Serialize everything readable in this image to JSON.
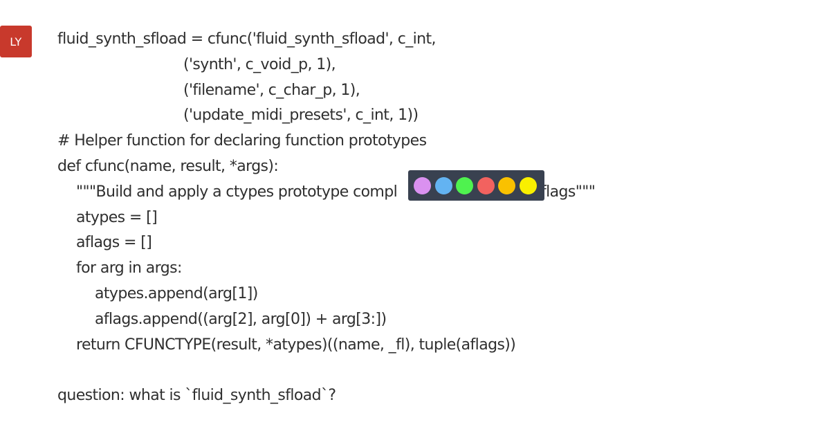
{
  "user": {
    "initials": "LY",
    "avatar_color": "#c8392c"
  },
  "message": {
    "code_lines": [
      "fluid_synth_sfload = cfunc('fluid_synth_sfload', c_int,",
      "('synth', c_void_p, 1),",
      "('filename', c_char_p, 1),",
      "('update_midi_presets', c_int, 1))",
      "# Helper function for declaring function prototypes",
      "def cfunc(name, result, *args):",
      "\"\"\"Build and apply a ctypes prototype compl",
      "r flags\"\"\"",
      "atypes = []",
      "aflags = []",
      "for arg in args:",
      "atypes.append(arg[1])",
      "aflags.append((arg[2], arg[0]) + arg[3:])",
      "return CFUNCTYPE(result, *atypes)((name, _fl), tuple(aflags))"
    ],
    "question": "question: what is `fluid_synth_sfload`?"
  },
  "palette": {
    "colors": [
      {
        "name": "violet",
        "hex": "#da91f0"
      },
      {
        "name": "blue",
        "hex": "#63b3f2"
      },
      {
        "name": "green",
        "hex": "#4ff24f"
      },
      {
        "name": "red",
        "hex": "#f2625f"
      },
      {
        "name": "orange",
        "hex": "#f9c100"
      },
      {
        "name": "yellow",
        "hex": "#f9ef00"
      }
    ]
  }
}
